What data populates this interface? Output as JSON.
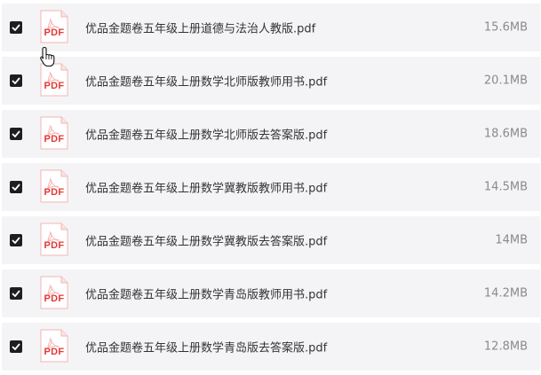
{
  "files": [
    {
      "name": "优品金题卷五年级上册道德与法治人教版.pdf",
      "size": "15.6MB",
      "icon_label": "PDF",
      "checked": true
    },
    {
      "name": "优品金题卷五年级上册数学北师版教师用书.pdf",
      "size": "20.1MB",
      "icon_label": "PDF",
      "checked": true
    },
    {
      "name": "优品金题卷五年级上册数学北师版去答案版.pdf",
      "size": "18.6MB",
      "icon_label": "PDF",
      "checked": true
    },
    {
      "name": "优品金题卷五年级上册数学冀教版教师用书.pdf",
      "size": "14.5MB",
      "icon_label": "PDF",
      "checked": true
    },
    {
      "name": "优品金题卷五年级上册数学冀教版去答案版.pdf",
      "size": "14MB",
      "icon_label": "PDF",
      "checked": true
    },
    {
      "name": "优品金题卷五年级上册数学青岛版教师用书.pdf",
      "size": "14.2MB",
      "icon_label": "PDF",
      "checked": true
    },
    {
      "name": "优品金题卷五年级上册数学青岛版去答案版.pdf",
      "size": "12.8MB",
      "icon_label": "PDF",
      "checked": true
    }
  ],
  "colors": {
    "row_background": "#f4f4f6",
    "checkbox": "#1e1e1e",
    "pdf_red": "#e53935",
    "name_text": "#333333",
    "size_text": "#8a8a8a"
  },
  "cursor": {
    "icon": "hand-pointer-icon"
  }
}
